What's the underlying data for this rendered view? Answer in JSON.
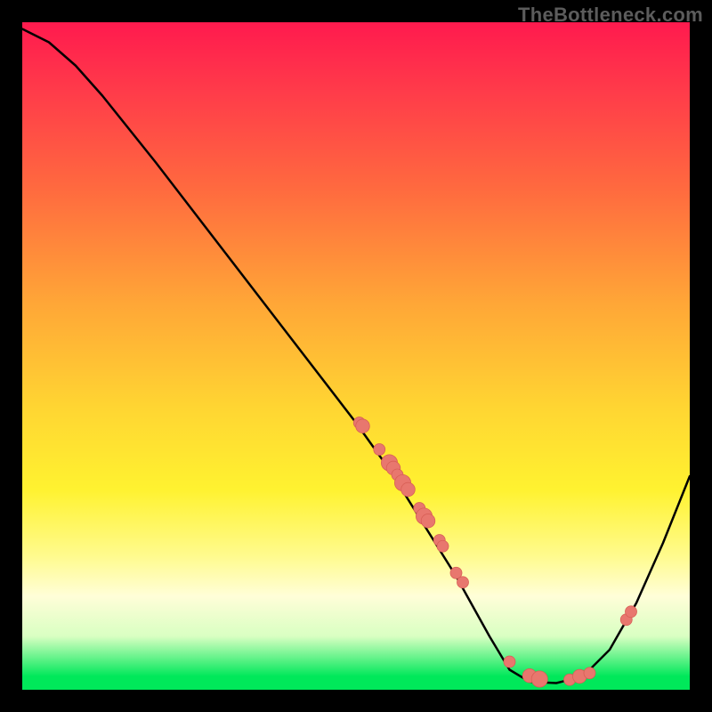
{
  "watermark": "TheBottleneck.com",
  "colors": {
    "curve": "#000000",
    "dot_fill": "#e8776e",
    "dot_stroke": "#d85f56",
    "background_black": "#000000"
  },
  "chart_data": {
    "type": "line",
    "title": "",
    "xlabel": "",
    "ylabel": "",
    "x_range": [
      0,
      100
    ],
    "y_range": [
      0,
      100
    ],
    "grid": false,
    "legend": false,
    "curve_note": "V-shaped bottleneck curve. High on left, descends nearly linearly to a flat minimum around x≈73–84, then rises steeply toward the right edge.",
    "curve": [
      {
        "x": 0,
        "y": 99
      },
      {
        "x": 4,
        "y": 97
      },
      {
        "x": 8,
        "y": 93.5
      },
      {
        "x": 12,
        "y": 89
      },
      {
        "x": 20,
        "y": 79
      },
      {
        "x": 30,
        "y": 66
      },
      {
        "x": 40,
        "y": 53
      },
      {
        "x": 50,
        "y": 40
      },
      {
        "x": 55,
        "y": 33
      },
      {
        "x": 60,
        "y": 25
      },
      {
        "x": 65,
        "y": 17
      },
      {
        "x": 70,
        "y": 8
      },
      {
        "x": 73,
        "y": 3
      },
      {
        "x": 76,
        "y": 1.2
      },
      {
        "x": 80,
        "y": 1
      },
      {
        "x": 84,
        "y": 2
      },
      {
        "x": 88,
        "y": 6
      },
      {
        "x": 92,
        "y": 13
      },
      {
        "x": 96,
        "y": 22
      },
      {
        "x": 100,
        "y": 32
      }
    ],
    "dots_note": "Highlighted sample points on/near the curve; sizes in relative px (rendered ≈1.3×).",
    "dots": [
      {
        "x": 50.5,
        "y": 40,
        "r": 5
      },
      {
        "x": 51.0,
        "y": 39.5,
        "r": 6
      },
      {
        "x": 53.5,
        "y": 36,
        "r": 5
      },
      {
        "x": 55.0,
        "y": 34,
        "r": 7
      },
      {
        "x": 55.6,
        "y": 33.2,
        "r": 6
      },
      {
        "x": 56.2,
        "y": 32.2,
        "r": 5
      },
      {
        "x": 57.0,
        "y": 31,
        "r": 7
      },
      {
        "x": 57.8,
        "y": 30,
        "r": 6
      },
      {
        "x": 59.5,
        "y": 27.2,
        "r": 5
      },
      {
        "x": 60.2,
        "y": 26,
        "r": 7
      },
      {
        "x": 60.8,
        "y": 25.3,
        "r": 6
      },
      {
        "x": 62.5,
        "y": 22.4,
        "r": 5
      },
      {
        "x": 63.0,
        "y": 21.5,
        "r": 5
      },
      {
        "x": 65.0,
        "y": 17.5,
        "r": 5
      },
      {
        "x": 66.0,
        "y": 16.1,
        "r": 5
      },
      {
        "x": 73.0,
        "y": 4.2,
        "r": 5
      },
      {
        "x": 76.0,
        "y": 2.1,
        "r": 6
      },
      {
        "x": 77.5,
        "y": 1.6,
        "r": 7
      },
      {
        "x": 82.0,
        "y": 1.5,
        "r": 5
      },
      {
        "x": 83.5,
        "y": 2.0,
        "r": 6
      },
      {
        "x": 85.0,
        "y": 2.5,
        "r": 5
      },
      {
        "x": 90.5,
        "y": 10.5,
        "r": 5
      },
      {
        "x": 91.2,
        "y": 11.7,
        "r": 5
      }
    ]
  }
}
